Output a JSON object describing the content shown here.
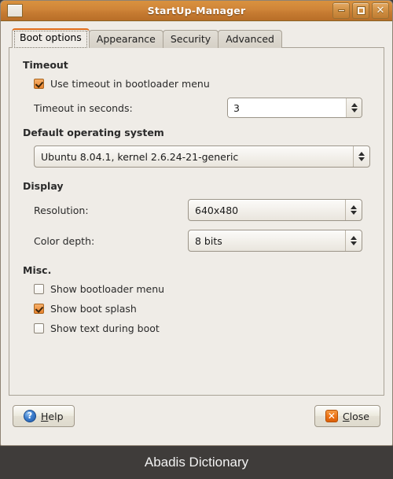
{
  "window": {
    "title": "StartUp-Manager",
    "icon": "window-icon",
    "controls": [
      {
        "name": "minimize-button",
        "glyph": "_"
      },
      {
        "name": "maximize-button",
        "glyph": "□"
      },
      {
        "name": "close-button",
        "glyph": "✕"
      }
    ]
  },
  "tabs": [
    {
      "label": "Boot options",
      "active": true
    },
    {
      "label": "Appearance",
      "active": false
    },
    {
      "label": "Security",
      "active": false
    },
    {
      "label": "Advanced",
      "active": false
    }
  ],
  "sections": {
    "timeout": {
      "title": "Timeout",
      "use_timeout_label": "Use timeout in bootloader menu",
      "use_timeout_checked": true,
      "seconds_label": "Timeout in seconds:",
      "seconds_value": "3"
    },
    "default_os": {
      "title": "Default operating system",
      "value": "Ubuntu 8.04.1, kernel 2.6.24-21-generic"
    },
    "display": {
      "title": "Display",
      "resolution_label": "Resolution:",
      "resolution_value": "640x480",
      "color_depth_label": "Color depth:",
      "color_depth_value": "8 bits"
    },
    "misc": {
      "title": "Misc.",
      "items": [
        {
          "label": "Show bootloader menu",
          "checked": false
        },
        {
          "label": "Show boot splash",
          "checked": true
        },
        {
          "label": "Show text during boot",
          "checked": false
        }
      ]
    }
  },
  "actions": {
    "help_mnemonic": "H",
    "help_rest": "elp",
    "help_icon": "?",
    "close_mnemonic": "C",
    "close_rest": "lose",
    "close_icon": "✕"
  },
  "footer": {
    "caption": "Abadis Dictionary"
  },
  "colors": {
    "titlebar": "#cf8438",
    "accent_orange": "#e06c1a",
    "content_bg": "#efece7",
    "footer_bg": "#3f3c3a",
    "checked_checkbox": "#e8832e",
    "help_icon_blue": "#3f7fce"
  }
}
